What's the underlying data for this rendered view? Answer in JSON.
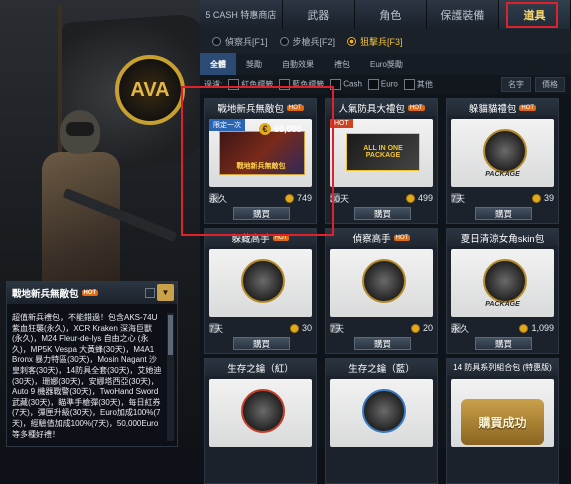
{
  "top_tabs": [
    {
      "label": "5 CASH 特惠商店"
    },
    {
      "label": "武器"
    },
    {
      "label": "角色"
    },
    {
      "label": "保護裝備"
    },
    {
      "label": "道具"
    }
  ],
  "class_radios": [
    {
      "label": "偵察兵[F1]",
      "selected": false
    },
    {
      "label": "步槍兵[F2]",
      "selected": false
    },
    {
      "label": "狙擊兵[F3]",
      "selected": true
    }
  ],
  "categories": [
    "全體",
    "獎勵",
    "自動效果",
    "禮包",
    "Euro獎勵"
  ],
  "filters": {
    "label": "過濾:",
    "options": [
      "紅色標籤",
      "藍色標籤",
      "Cash",
      "Euro",
      "其他"
    ],
    "sort": [
      "名字",
      "價格"
    ]
  },
  "emblem_text": "AVA",
  "items": [
    {
      "name": "戰地新兵無敵包",
      "hot": "HOT",
      "duration": "永久",
      "price": "749",
      "buy": "購買",
      "ribbon": "限定一次",
      "bonus": "60,000",
      "banner": "戰地新兵無敵包"
    },
    {
      "name": "人氣防具大禮包",
      "hot": "HOT",
      "duration": "30天",
      "price": "499",
      "buy": "購買",
      "ribbon": "HOT",
      "banner": "ALL IN ONE PACKAGE"
    },
    {
      "name": "躲貓貓禮包",
      "hot": "HOT",
      "duration": "7天",
      "price": "39",
      "buy": "購買",
      "package": "PACKAGE"
    },
    {
      "name": "躲藏高手",
      "hot": "HOT",
      "duration": "7天",
      "price": "30",
      "buy": "購買"
    },
    {
      "name": "偵察高手",
      "hot": "HOT",
      "duration": "7天",
      "price": "20",
      "buy": "購買"
    },
    {
      "name": "夏日清涼女角skin包",
      "hot": "",
      "duration": "永久",
      "price": "1,099",
      "buy": "購買",
      "package": "PACKAGE"
    },
    {
      "name": "生存之鑰（紅）",
      "hot": "",
      "duration": "",
      "price": "",
      "buy": ""
    },
    {
      "name": "生存之鑰（藍）",
      "hot": "",
      "duration": "",
      "price": "",
      "buy": ""
    },
    {
      "name": "14 防具系列組合包 (特惠版)",
      "hot": "",
      "duration": "",
      "price": "",
      "buy": "",
      "overlay": "購買成功"
    }
  ],
  "info_panel": {
    "title": "戰地新兵無敵包",
    "hot": "HOT",
    "body": "超值新兵禮包，不能錯過！包含AKS-74U 紫血狂襲(永久)，XCR Kraken 深海巨獸(永久)，M24 Fleur-de-lys 自由之心 (永久)，MP5K Vespa 大黃蜂(30天)，M4A1 Bronx 暴力特區(30天)，Mosin Nagant 沙皇刺客(30天)，14防具全套(30天)，艾她迪(30天)，珊娜(30天)，安娜塔西亞(30天)，Auto 9 機器戰警(30天)，TwoHand Sword 武藏(30天)，瞄準手槍彈(30天)，每日紅券(7天)，彈匣升級(30天)，Euro加成100%(7天)，經驗值加成100%(7天)，50,000Euro等多種好禮！"
  },
  "colors": {
    "accent": "#f0b21c",
    "highlight": "#e0202a",
    "active_category": "#2b4a74"
  }
}
